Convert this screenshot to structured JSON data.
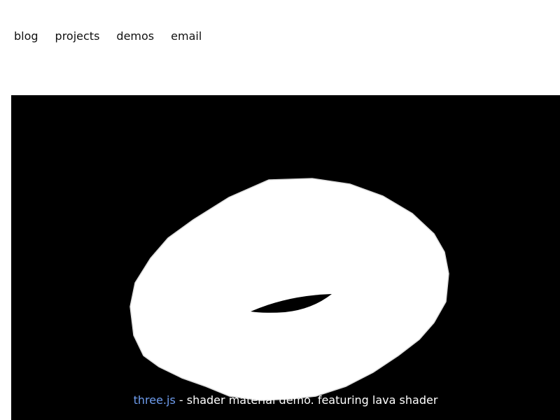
{
  "nav": {
    "items": [
      {
        "label": "blog"
      },
      {
        "label": "projects"
      },
      {
        "label": "demos"
      },
      {
        "label": "email"
      }
    ]
  },
  "demo": {
    "info_link": "three.js",
    "info_text": " - shader material demo. featuring lava shader"
  },
  "colors": {
    "page_background": "#ffffff",
    "viewport_background": "#000000",
    "torus_fill": "#ffffff",
    "link_color": "#6f9ef0",
    "caption_color": "#ffffff"
  }
}
